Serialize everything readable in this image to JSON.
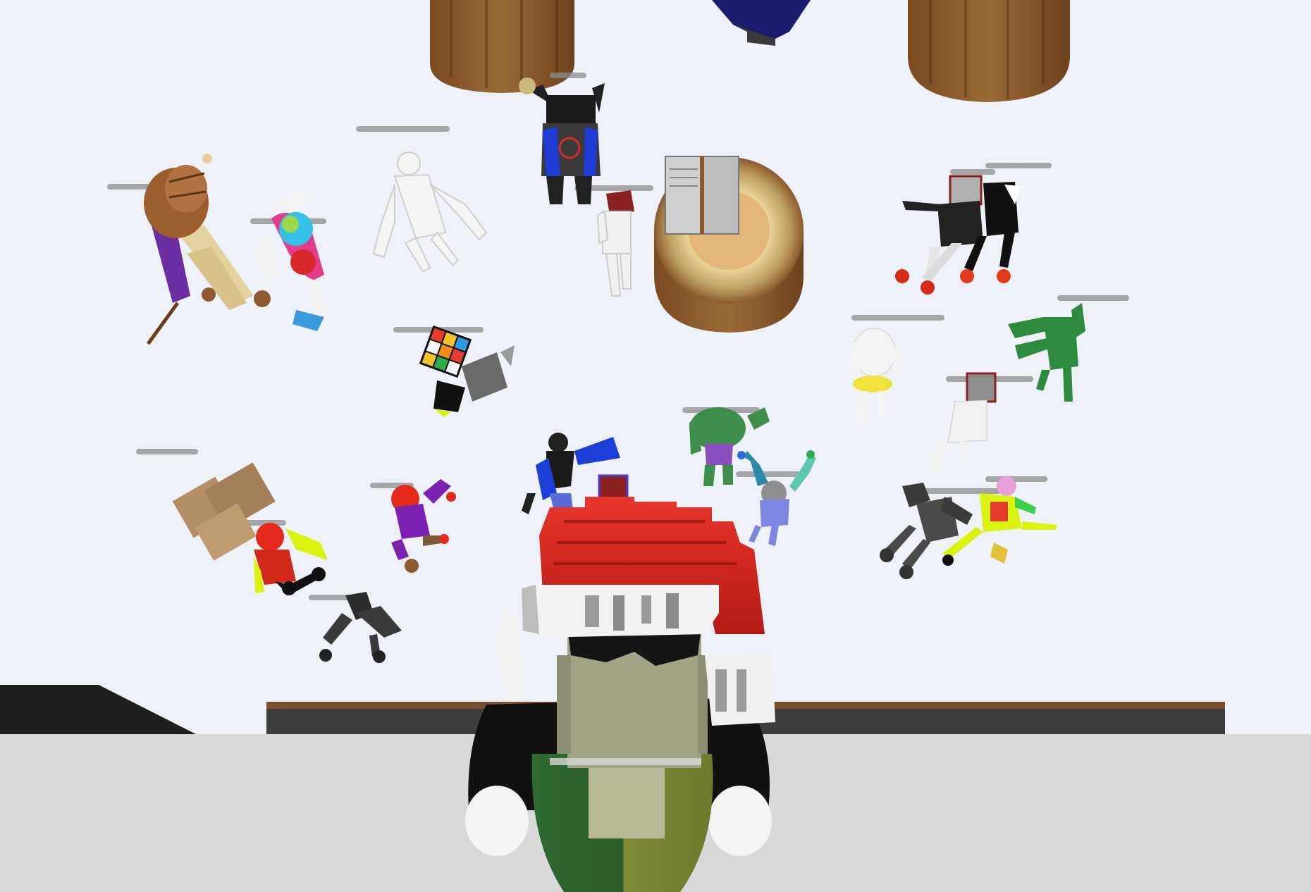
{
  "scene": {
    "name": "snow-plaza-top-down-view",
    "colors": {
      "snow": "#eef2f8",
      "snow_shadow": "#d7dfea",
      "floor": "#d9d9d9",
      "wall_top": "#7a4f2e",
      "wall_face": "#3c3c3c",
      "stump_bark": "#8a5a2b",
      "stump_top": "#e2b77a",
      "santa_hat_red": "#d8261f",
      "santa_hat_trim": "#f2f2f2"
    }
  },
  "avatars": [
    {
      "id": "top-hat-avatar",
      "color": "#6b2fa3",
      "nametag": ""
    },
    {
      "id": "rainbow-avatar",
      "color": "#e43c8a",
      "nametag": ""
    },
    {
      "id": "white-mannequin-avatar",
      "color": "#f4f4f4",
      "nametag": ""
    },
    {
      "id": "black-blue-armor-avatar",
      "color": "#1f3bd6",
      "nametag": ""
    },
    {
      "id": "white-robot-avatar",
      "color": "#ededed",
      "nametag": ""
    },
    {
      "id": "red-black-avatar",
      "color": "#222222",
      "nametag": ""
    },
    {
      "id": "black-hoodie-avatar",
      "color": "#1b1b1b",
      "nametag": ""
    },
    {
      "id": "green-goblin-avatar",
      "color": "#2e8b3e",
      "nametag": ""
    },
    {
      "id": "white-yellow-avatar",
      "color": "#f0f0f0",
      "nametag": ""
    },
    {
      "id": "white-tv-head-avatar",
      "color": "#eeeeee",
      "nametag": ""
    },
    {
      "id": "rubiks-cube-avatar",
      "color": "#111111",
      "nametag": ""
    },
    {
      "id": "cardboard-box-avatar",
      "color": "#b08a63",
      "nametag": ""
    },
    {
      "id": "red-hood-neon-avatar",
      "color": "#e32a1b",
      "nametag": ""
    },
    {
      "id": "red-purple-avatar",
      "color": "#7b22b4",
      "nametag": ""
    },
    {
      "id": "blue-black-avatar",
      "color": "#1c3fd8",
      "nametag": ""
    },
    {
      "id": "green-hulk-avatar",
      "color": "#3f8d4a",
      "nametag": ""
    },
    {
      "id": "blue-raised-arms-avatar",
      "color": "#7c86e0",
      "nametag": ""
    },
    {
      "id": "gray-crouching-avatar",
      "color": "#3a3a3a",
      "nametag": ""
    },
    {
      "id": "neon-yellow-avatar",
      "color": "#d9f20f",
      "nametag": ""
    },
    {
      "id": "dark-gray-avatar",
      "color": "#2d2d2d",
      "nametag": ""
    }
  ],
  "player": {
    "id": "player-avatar",
    "hat": "santa-hat",
    "nametag": ""
  }
}
